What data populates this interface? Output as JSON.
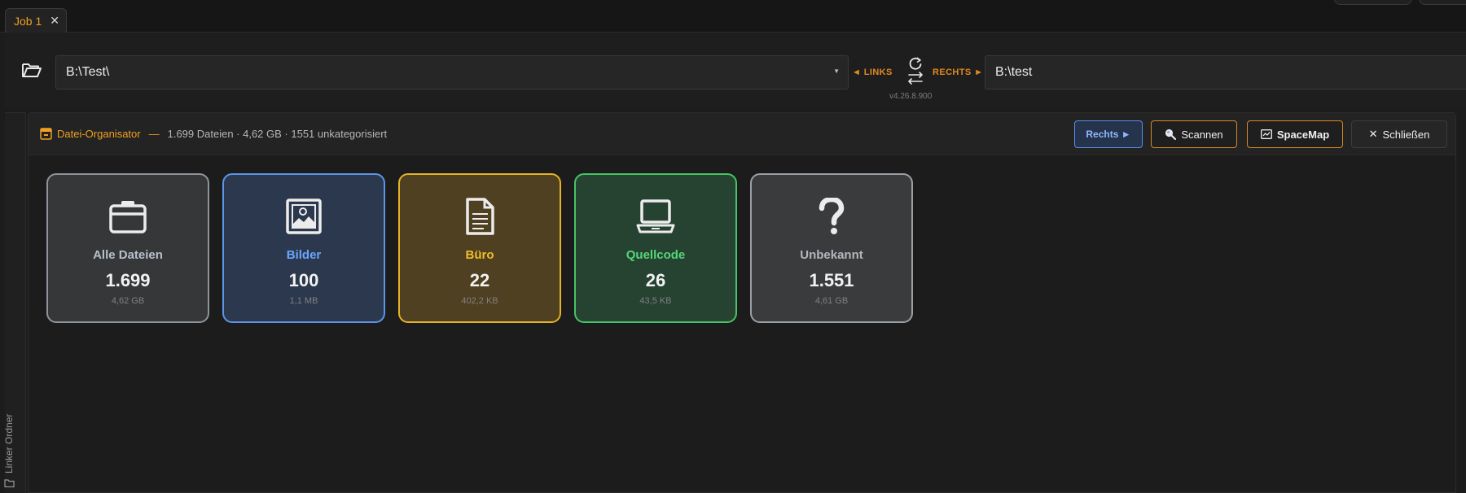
{
  "tab": {
    "label": "Job 1",
    "close": "✕"
  },
  "pathbar": {
    "left_path": "B:\\Test\\",
    "right_path": "B:\\test",
    "links_label": "◄ LINKS",
    "rechts_label": "RECHTS ►",
    "version": "v4.26.8.900"
  },
  "rail": {
    "label": "Linker Ordner"
  },
  "panel": {
    "title": "Datei-Organisator",
    "dash": "—",
    "stats": "1.699 Dateien · 4,62 GB · 1551 unkategorisiert",
    "buttons": {
      "rechts": "Rechts ►",
      "scan": "Scannen",
      "spacemap": "SpaceMap",
      "close": "Schließen"
    }
  },
  "cards": [
    {
      "name": "Alle Dateien",
      "count": "1.699",
      "size": "4,62 GB",
      "icon": "folder-icon"
    },
    {
      "name": "Bilder",
      "count": "100",
      "size": "1,1 MB",
      "icon": "image-icon"
    },
    {
      "name": "Büro",
      "count": "22",
      "size": "402,2 KB",
      "icon": "document-icon"
    },
    {
      "name": "Quellcode",
      "count": "26",
      "size": "43,5 KB",
      "icon": "laptop-icon"
    },
    {
      "name": "Unbekannt",
      "count": "1.551",
      "size": "4,61 GB",
      "icon": "question-icon"
    }
  ],
  "colors": {
    "accent": "#f0a020",
    "bilder": "#6aa6ff",
    "buero": "#f2bd2c",
    "quellcode": "#56d679"
  }
}
